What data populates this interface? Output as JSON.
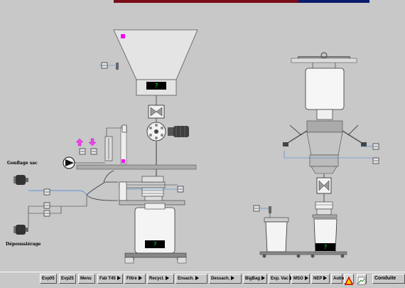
{
  "labels": {
    "gonflage": "Gonflage sac",
    "depoussierage": "Dépoussiérage"
  },
  "displays": {
    "hopper": "?",
    "container_left": "?",
    "container_right": "?"
  },
  "toolbar": {
    "buttons": [
      {
        "label": "Evp05",
        "arrow": false
      },
      {
        "label": "Evp25",
        "arrow": false
      },
      {
        "label": "Menu",
        "arrow": false
      },
      {
        "label": "Fab T45",
        "arrow": true
      },
      {
        "label": "Filtre",
        "arrow": true
      },
      {
        "label": "Recycl.",
        "arrow": true
      },
      {
        "label": "Ensach.",
        "arrow": true
      },
      {
        "label": "Dessach.",
        "arrow": true
      },
      {
        "label": "BigBag",
        "arrow": true
      },
      {
        "label": "Exp. Vac",
        "arrow": true
      },
      {
        "label": "MSO",
        "arrow": true
      },
      {
        "label": "NEP",
        "arrow": true
      },
      {
        "label": "Autres",
        "arrow": false
      }
    ],
    "conduite": "Conduite"
  },
  "colors": {
    "background": "#c8c8c8",
    "equipment": "#ededed",
    "alarm_marker": "#ff00ff",
    "pipe_blue": "#3a7fd9",
    "display_text": "#00ff30"
  },
  "icons": [
    "pump-icon",
    "fan-icon",
    "valve-icon",
    "motor-icon",
    "warning-icon",
    "trend-icon"
  ]
}
